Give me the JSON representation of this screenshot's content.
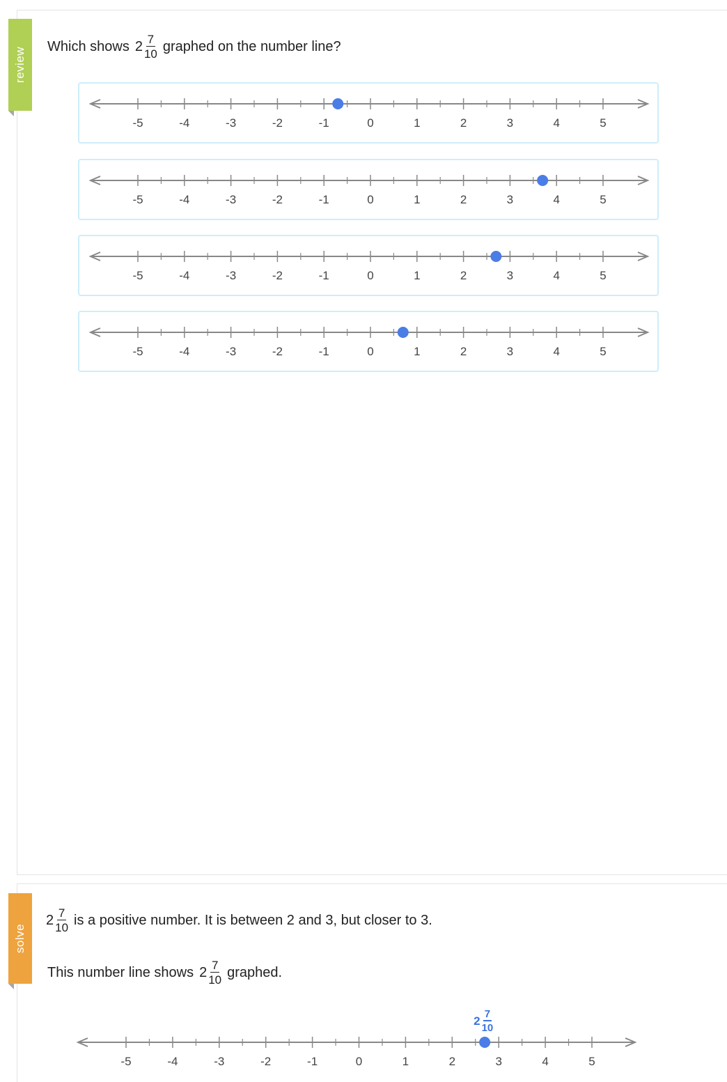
{
  "sidebar": {
    "review_label": "review",
    "solve_label": "solve",
    "review_color": "#b0cf55",
    "solve_color": "#eea33e"
  },
  "question": {
    "prefix": "Which shows",
    "whole": "2",
    "numerator": "7",
    "denominator": "10",
    "suffix": "graphed on the number line?"
  },
  "number_line": {
    "tick_labels": [
      "-5",
      "-4",
      "-3",
      "-2",
      "-1",
      "0",
      "1",
      "2",
      "3",
      "4",
      "5"
    ],
    "point_color": "#4a7de6",
    "axis_color": "#888888"
  },
  "choices": [
    {
      "point_value": -0.7
    },
    {
      "point_value": 3.7
    },
    {
      "point_value": 2.7
    },
    {
      "point_value": 0.7
    }
  ],
  "solution": {
    "line1": {
      "whole": "2",
      "numerator": "7",
      "denominator": "10",
      "text": "is a positive number. It is between 2 and 3, but closer to 3."
    },
    "line2": {
      "prefix": "This number line shows",
      "whole": "2",
      "numerator": "7",
      "denominator": "10",
      "suffix": "graphed."
    },
    "point_label": {
      "whole": "2",
      "numerator": "7",
      "denominator": "10"
    },
    "point_value": 2.7
  }
}
